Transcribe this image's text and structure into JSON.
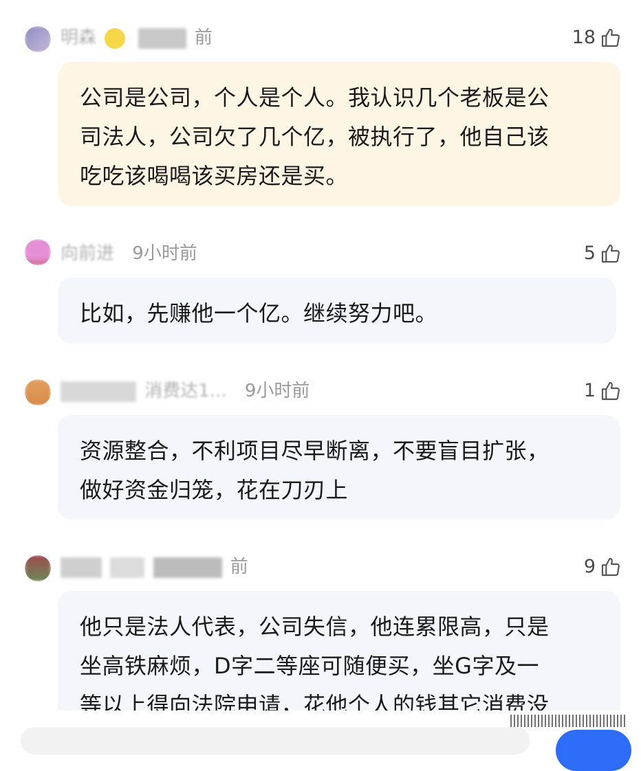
{
  "comments": [
    {
      "user": "明森",
      "time": "前",
      "likes": "18",
      "text_lines": [
        "公司是公司，个人是个人。我认识几个老板是公",
        "司法人，公司欠了几个亿，被执行了，他自己该",
        "吃吃该喝喝该买房还是买。"
      ]
    },
    {
      "user": "向前进",
      "time": "9小时前",
      "likes": "5",
      "text_lines": [
        "比如，先赚他一个亿。继续努力吧。"
      ]
    },
    {
      "user": "消费达1...",
      "time": "9小时前",
      "likes": "1",
      "text_lines": [
        "资源整合，不利项目尽早断离，不要盲目扩张，",
        "做好资金归笼，花在刀刃上"
      ]
    },
    {
      "user": "",
      "time": "前",
      "likes": "9",
      "text_lines": [
        "他只是法人代表，公司失信，他连累限高，只是",
        "坐高铁麻烦，D字二等座可随便买，坐G字及一",
        "等以上得向法院申请，花他个人的钱其它消费没"
      ]
    }
  ],
  "icons": {
    "like": "thumbs-up-icon"
  },
  "colors": {
    "highlight_bubble": "#fdf6e5",
    "normal_bubble": "#f3f6fb",
    "accent": "#2d6cf6"
  }
}
